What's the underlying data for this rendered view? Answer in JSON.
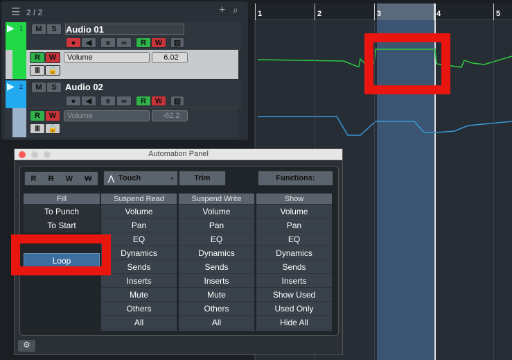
{
  "track_list": {
    "count": "2 / 2",
    "tracks": [
      {
        "number": "1",
        "name": "Audio 01",
        "color": "#22d847",
        "lane": {
          "param": "Volume",
          "value": "6.02"
        }
      },
      {
        "number": "2",
        "name": "Audio 02",
        "color": "#22a9f0",
        "lane": {
          "param": "Volume",
          "value": "-62.2"
        }
      }
    ],
    "mute": "M",
    "solo": "S",
    "read": "R",
    "write": "W"
  },
  "ruler": {
    "bars": [
      "1",
      "2",
      "3",
      "4",
      "5"
    ]
  },
  "panel": {
    "title": "Automation Panel",
    "modes": [
      "R",
      "R",
      "W",
      "W"
    ],
    "mode_select": "Touch",
    "trim": "Trim",
    "functions": "Functions:",
    "fill": {
      "header": "Fill",
      "items": [
        "To Punch",
        "To Start",
        "Loop"
      ]
    },
    "suspend_read": {
      "header": "Suspend Read",
      "items": [
        "Volume",
        "Pan",
        "EQ",
        "Dynamics",
        "Sends",
        "Inserts",
        "Mute",
        "Others",
        "All"
      ]
    },
    "suspend_write": {
      "header": "Suspend Write",
      "items": [
        "Volume",
        "Pan",
        "EQ",
        "Dynamics",
        "Sends",
        "Inserts",
        "Mute",
        "Others",
        "All"
      ]
    },
    "show": {
      "header": "Show",
      "items": [
        "Volume",
        "Pan",
        "EQ",
        "Dynamics",
        "Sends",
        "Inserts",
        "Show Used",
        "Used Only",
        "Hide All"
      ]
    }
  },
  "colors": {
    "highlight": "#e8160f",
    "loop_region": "#3b5573",
    "green_line": "#2ecc40",
    "blue_line": "#3a9ad9"
  }
}
